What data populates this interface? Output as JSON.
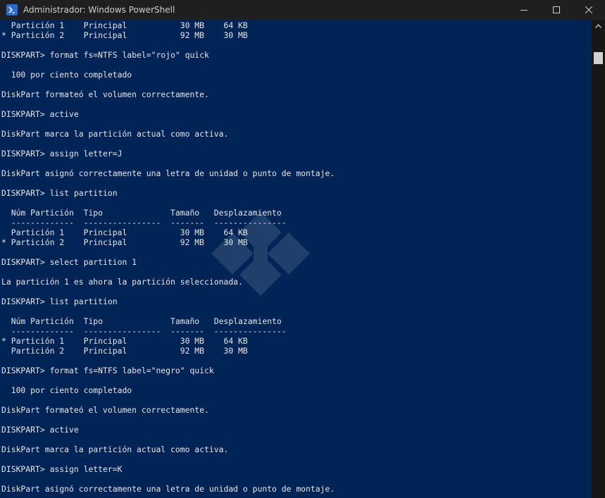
{
  "window": {
    "title": "Administrador: Windows PowerShell",
    "colors": {
      "console_background": "#012456",
      "console_text": "#e6e6e6",
      "titlebar": "#1f1f1f"
    },
    "icons": {
      "app": "powershell-icon",
      "minimize": "minimize-icon",
      "maximize": "maximize-icon",
      "close": "close-icon"
    }
  },
  "console": {
    "lines": [
      "  Partición 1    Principal           30 MB    64 KB",
      "* Partición 2    Principal           92 MB    30 MB",
      "",
      "DISKPART> format fs=NTFS label=\"rojo\" quick",
      "",
      "  100 por ciento completado",
      "",
      "DiskPart formateó el volumen correctamente.",
      "",
      "DISKPART> active",
      "",
      "DiskPart marca la partición actual como activa.",
      "",
      "DISKPART> assign letter=J",
      "",
      "DiskPart asignó correctamente una letra de unidad o punto de montaje.",
      "",
      "DISKPART> list partition",
      "",
      "  Núm Partición  Tipo              Tamaño   Desplazamiento",
      "  -------------  ----------------  -------  ---------------",
      "  Partición 1    Principal           30 MB    64 KB",
      "* Partición 2    Principal           92 MB    30 MB",
      "",
      "DISKPART> select partition 1",
      "",
      "La partición 1 es ahora la partición seleccionada.",
      "",
      "DISKPART> list partition",
      "",
      "  Núm Partición  Tipo              Tamaño   Desplazamiento",
      "  -------------  ----------------  -------  ---------------",
      "* Partición 1    Principal           30 MB    64 KB",
      "  Partición 2    Principal           92 MB    30 MB",
      "",
      "DISKPART> format fs=NTFS label=\"negro\" quick",
      "",
      "  100 por ciento completado",
      "",
      "DiskPart formateó el volumen correctamente.",
      "",
      "DISKPART> active",
      "",
      "DiskPart marca la partición actual como activa.",
      "",
      "DISKPART> assign letter=K",
      "",
      "DiskPart asignó correctamente una letra de unidad o punto de montaje."
    ]
  }
}
